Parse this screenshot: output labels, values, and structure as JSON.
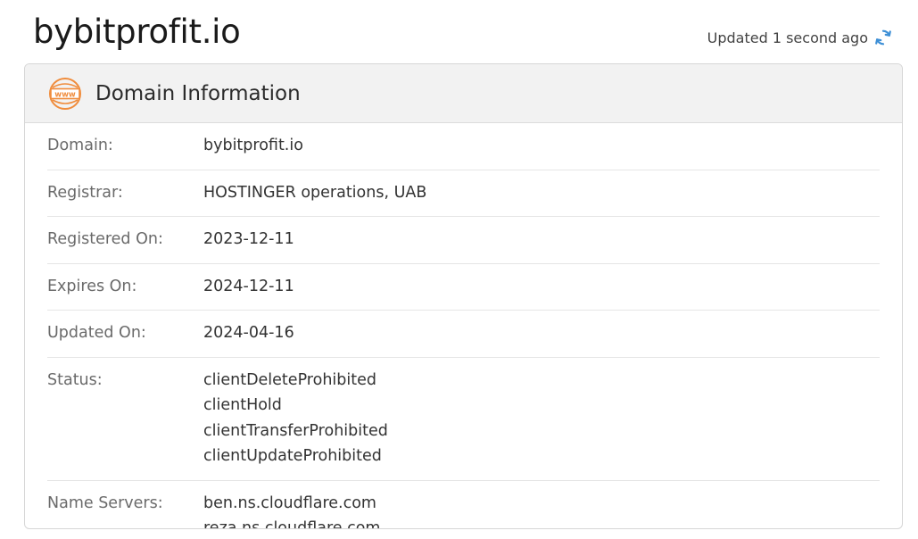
{
  "header": {
    "site_title": "bybitprofit.io",
    "updated_text": "Updated 1 second ago",
    "refresh_icon": "refresh-icon"
  },
  "card": {
    "title": "Domain Information",
    "icon": "www-icon",
    "icon_text": "www",
    "accent_color": "#f08c3c",
    "rows": [
      {
        "label": "Domain:",
        "values": [
          "bybitprofit.io"
        ]
      },
      {
        "label": "Registrar:",
        "values": [
          "HOSTINGER operations, UAB"
        ]
      },
      {
        "label": "Registered On:",
        "values": [
          "2023-12-11"
        ]
      },
      {
        "label": "Expires On:",
        "values": [
          "2024-12-11"
        ]
      },
      {
        "label": "Updated On:",
        "values": [
          "2024-04-16"
        ]
      },
      {
        "label": "Status:",
        "values": [
          "clientDeleteProhibited",
          "clientHold",
          "clientTransferProhibited",
          "clientUpdateProhibited"
        ]
      },
      {
        "label": "Name Servers:",
        "values": [
          "ben.ns.cloudflare.com",
          "reza.ns.cloudflare.com"
        ]
      }
    ]
  }
}
